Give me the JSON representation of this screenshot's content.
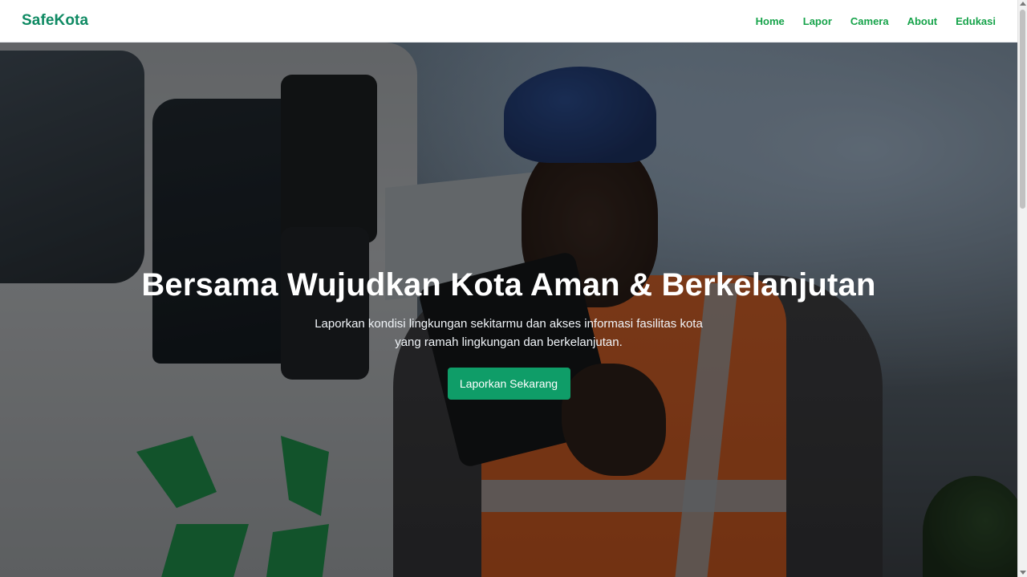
{
  "brand": "SafeKota",
  "nav": {
    "items": [
      {
        "label": "Home"
      },
      {
        "label": "Lapor"
      },
      {
        "label": "Camera"
      },
      {
        "label": "About"
      },
      {
        "label": "Edukasi"
      }
    ]
  },
  "hero": {
    "title": "Bersama Wujudkan Kota Aman & Berkelanjutan",
    "subtitle_line1": "Laporkan kondisi lingkungan sekitarmu dan akses informasi fasilitas kota",
    "subtitle_line2": "yang ramah lingkungan dan berkelanjutan.",
    "cta_label": "Laporkan Sekarang",
    "background_image": "worker-with-tablet-recycling-truck"
  },
  "colors": {
    "brand": "#0f8a63",
    "nav_link": "#16a34a",
    "cta_bg": "#0f9d68"
  }
}
